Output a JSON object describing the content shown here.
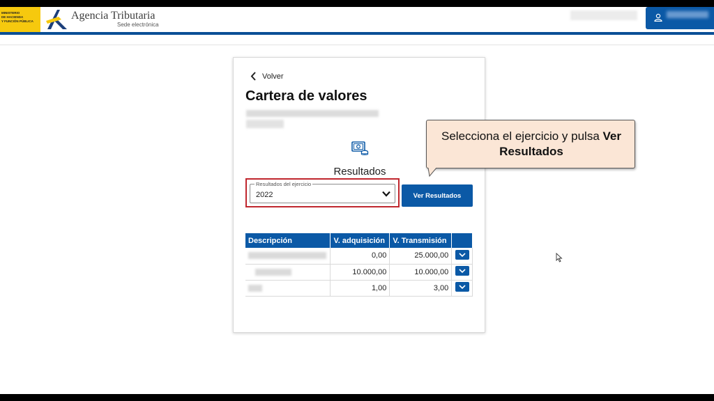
{
  "header": {
    "ministry_lines": [
      "MINISTERIO",
      "DE HACIENDA",
      "Y FUNCIÓN PÚBLICA"
    ],
    "brand_name": "Agencia Tributaria",
    "brand_sub": "Sede electrónica",
    "accent": "#0b4f96"
  },
  "card": {
    "back_label": "Volver",
    "title": "Cartera de valores",
    "section_label": "Resultados",
    "select": {
      "legend": "Resultados del ejercicio",
      "value": "2022"
    },
    "ver_button": "Ver Resultados",
    "table": {
      "headers": [
        "Descripción",
        "V. adquisición",
        "V. Transmisión",
        ""
      ],
      "rows": [
        {
          "adquisicion": "0,00",
          "transmision": "25.000,00"
        },
        {
          "adquisicion": "10.000,00",
          "transmision": "10.000,00"
        },
        {
          "adquisicion": "1,00",
          "transmision": "3,00"
        }
      ]
    }
  },
  "tooltip": {
    "text_plain": "Selecciona el ejercicio y pulsa ",
    "text_bold1": "Ver",
    "text_bold2": "Resultados"
  },
  "colors": {
    "primary": "#0b59a6",
    "highlight_border": "#c0262d",
    "tooltip_bg": "#fbe6d6",
    "ministry_yellow": "#f6c90e"
  }
}
